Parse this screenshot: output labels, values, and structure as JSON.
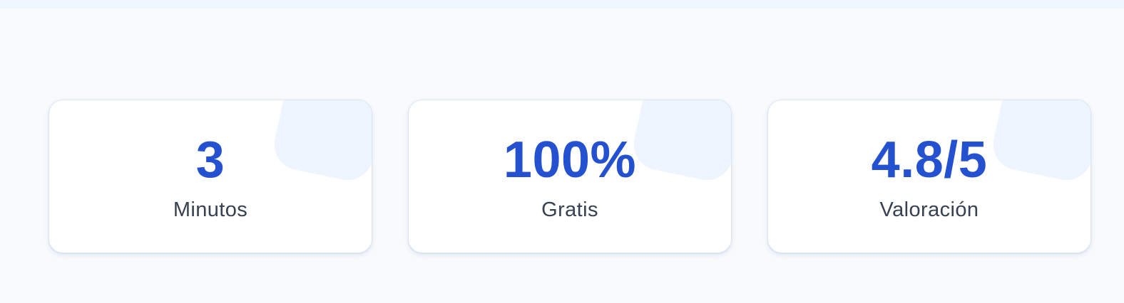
{
  "stats": [
    {
      "value": "3",
      "label": "Minutos"
    },
    {
      "value": "100%",
      "label": "Gratis"
    },
    {
      "value": "4.8/5",
      "label": "Valoración"
    }
  ],
  "colors": {
    "accent": "#2451cf",
    "label": "#374151",
    "card_background": "#ffffff",
    "page_background": "#f8fafc",
    "decoration": "#eef5fe"
  }
}
